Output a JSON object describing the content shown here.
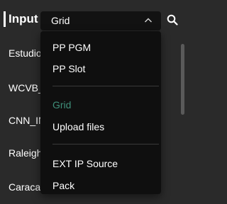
{
  "header": {
    "title": "Input",
    "select_value": "Grid"
  },
  "list": {
    "items": [
      "Estudio_",
      "WCVB_F",
      "CNN_IN",
      "Raleigh_",
      "Caracas"
    ]
  },
  "dropdown": {
    "options": [
      "PP PGM",
      "PP Slot",
      "Grid",
      "Upload files",
      "EXT IP Source",
      "Pack"
    ],
    "selected": "Grid"
  },
  "colors": {
    "background": "#2a2a2a",
    "dropdown_bg": "#0f0f0f",
    "selected_text": "#3f8f7a",
    "text": "#ffffff"
  },
  "icons": {
    "select_chevron": "chevron-up-icon",
    "search": "search-icon"
  }
}
